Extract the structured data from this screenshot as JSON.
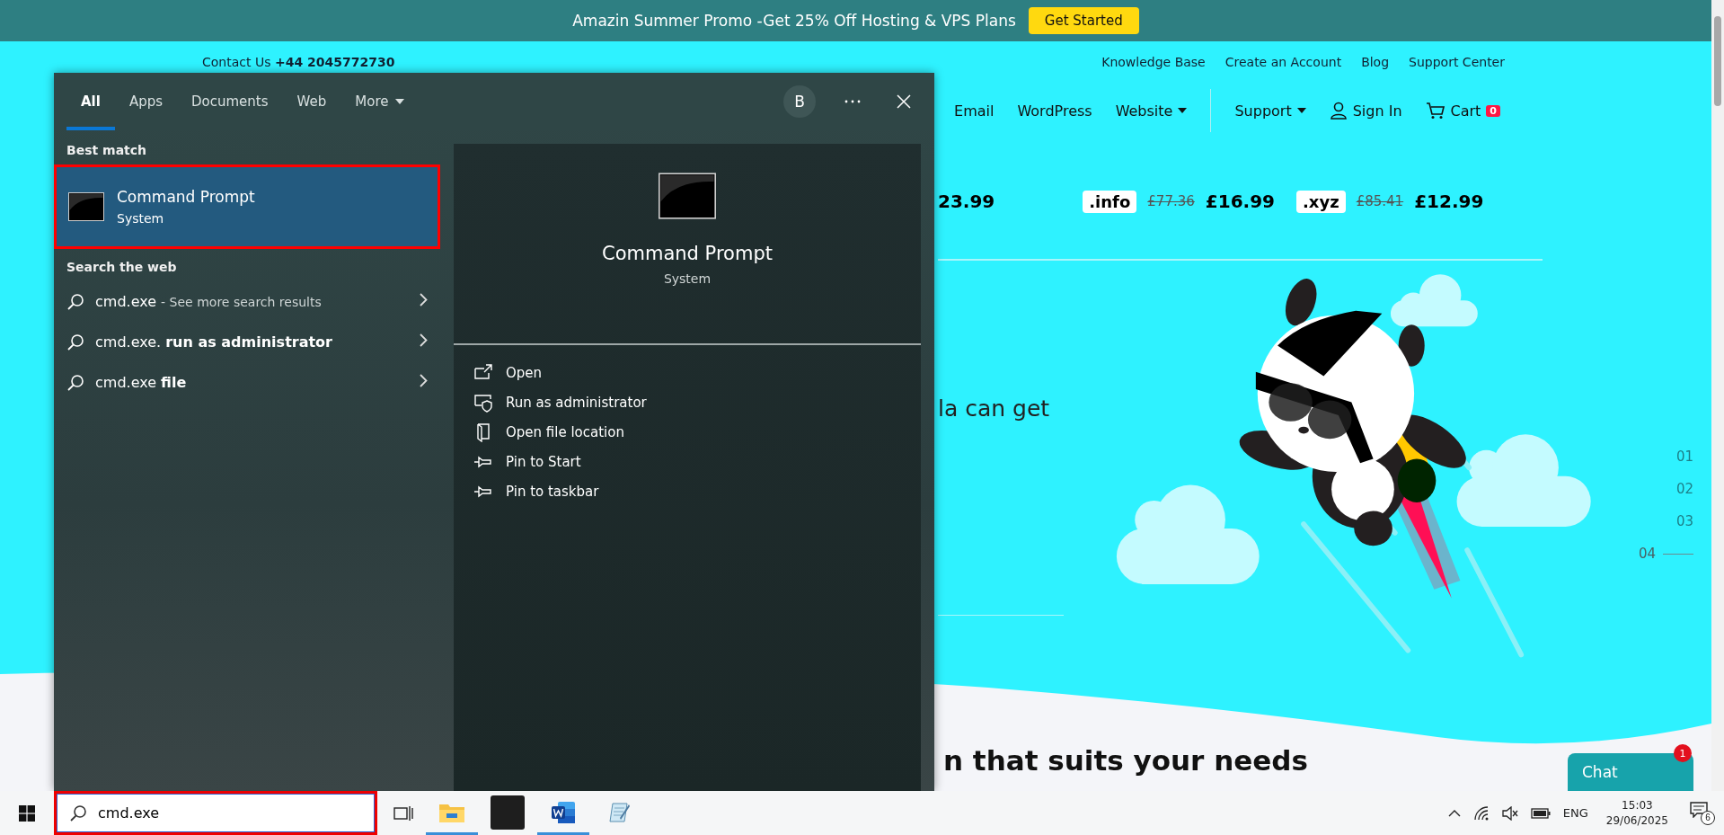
{
  "promo_bar": {
    "text": "Amazin Summer Promo -Get 25% Off Hosting & VPS Plans",
    "button": "Get Started"
  },
  "top_bar": {
    "contact_label": "Contact Us",
    "phone": "+44 2045772730",
    "links": [
      "Knowledge Base",
      "Create an Account",
      "Blog",
      "Support Center"
    ]
  },
  "nav": {
    "items": [
      {
        "label": "Email",
        "kind": "link"
      },
      {
        "label": "WordPress",
        "kind": "link"
      },
      {
        "label": "Website",
        "kind": "dropdown"
      },
      {
        "label": "Support",
        "kind": "dropdown"
      },
      {
        "label": "Sign In",
        "kind": "user"
      },
      {
        "label": "Cart",
        "kind": "cart",
        "badge": "0"
      }
    ]
  },
  "domains": [
    {
      "price": "23.99"
    },
    {
      "tld": ".info",
      "old_price": "£77.36",
      "price": "£16.99"
    },
    {
      "tld": ".xyz",
      "old_price": "£85.41",
      "price": "£12.99"
    }
  ],
  "hero": {
    "text": "la can get",
    "slides": [
      {
        "label": "01",
        "selected": false
      },
      {
        "label": "02",
        "selected": false
      },
      {
        "label": "03",
        "selected": false
      },
      {
        "label": "04",
        "selected": true
      }
    ]
  },
  "section_heading": "n that suits your needs",
  "chat": {
    "label": "Chat",
    "badge": "1"
  },
  "start_menu": {
    "tabs": [
      {
        "label": "All",
        "selected": true,
        "kind": "plain"
      },
      {
        "label": "Apps",
        "selected": false,
        "kind": "plain"
      },
      {
        "label": "Documents",
        "selected": false,
        "kind": "plain"
      },
      {
        "label": "Web",
        "selected": false,
        "kind": "plain"
      },
      {
        "label": "More",
        "selected": false,
        "kind": "dropdown"
      }
    ],
    "account_initial": "B",
    "best_match_heading": "Best match",
    "best_match": {
      "title": "Command Prompt",
      "subtitle": "System",
      "selected": true
    },
    "web_heading": "Search the web",
    "web_results": [
      {
        "kind": "more",
        "query": "cmd.exe",
        "hint": "- See more search results"
      },
      {
        "kind": "suggestion",
        "text": "cmd.exe. **run as administrator**"
      },
      {
        "kind": "suggestion",
        "text": "cmd.exe **file**"
      }
    ],
    "preview": {
      "title": "Command Prompt",
      "subtitle": "System"
    },
    "actions": [
      {
        "label": "Open",
        "kind": "open"
      },
      {
        "label": "Run as administrator",
        "kind": "admin"
      },
      {
        "label": "Open file location",
        "kind": "location"
      },
      {
        "label": "Pin to Start",
        "kind": "pin"
      },
      {
        "label": "Pin to taskbar",
        "kind": "pin"
      }
    ]
  },
  "taskbar": {
    "search_value": "cmd.exe",
    "apps": [
      {
        "kind": "explorer",
        "running": true
      },
      {
        "kind": "blank",
        "running": false
      },
      {
        "kind": "word",
        "running": true
      },
      {
        "kind": "notepad",
        "running": false
      }
    ],
    "language": "ENG",
    "time": "15:03",
    "date": "29/06/2025",
    "notifications": "6"
  }
}
